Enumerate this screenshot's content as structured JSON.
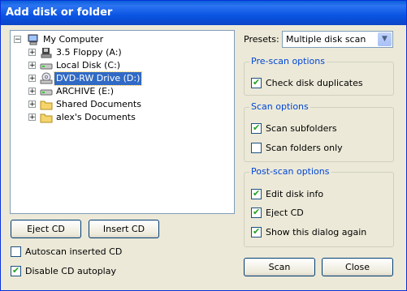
{
  "window": {
    "title": "Add disk or folder"
  },
  "tree": {
    "root": "My Computer",
    "items": [
      {
        "label": "3.5 Floppy (A:)",
        "icon": "floppy-icon"
      },
      {
        "label": "Local Disk (C:)",
        "icon": "drive-icon"
      },
      {
        "label": "DVD-RW Drive (D:)",
        "icon": "dvd-drive-icon",
        "selected": true
      },
      {
        "label": "ARCHIVE (E:)",
        "icon": "drive-icon"
      },
      {
        "label": "Shared Documents",
        "icon": "folder-icon"
      },
      {
        "label": "alex's Documents",
        "icon": "folder-icon"
      }
    ]
  },
  "buttons": {
    "eject": "Eject CD",
    "insert": "Insert CD",
    "scan": "Scan",
    "close": "Close"
  },
  "bottom_options": {
    "autoscan": {
      "label": "Autoscan inserted CD",
      "checked": false
    },
    "disable_autoplay": {
      "label": "Disable CD autoplay",
      "checked": true
    }
  },
  "presets": {
    "label": "Presets:",
    "value": "Multiple disk scan"
  },
  "groups": {
    "prescan": {
      "title": "Pre-scan options",
      "items": [
        {
          "label": "Check disk duplicates",
          "checked": true
        }
      ]
    },
    "scan": {
      "title": "Scan options",
      "items": [
        {
          "label": "Scan subfolders",
          "checked": true
        },
        {
          "label": "Scan folders only",
          "checked": false
        }
      ]
    },
    "postscan": {
      "title": "Post-scan options",
      "items": [
        {
          "label": "Edit disk info",
          "checked": true
        },
        {
          "label": "Eject CD",
          "checked": true
        },
        {
          "label": "Show this dialog again",
          "checked": true
        }
      ]
    }
  },
  "colors": {
    "title_bar": "#0a54e3",
    "selection": "#316ac5",
    "group_title": "#0046d5"
  }
}
